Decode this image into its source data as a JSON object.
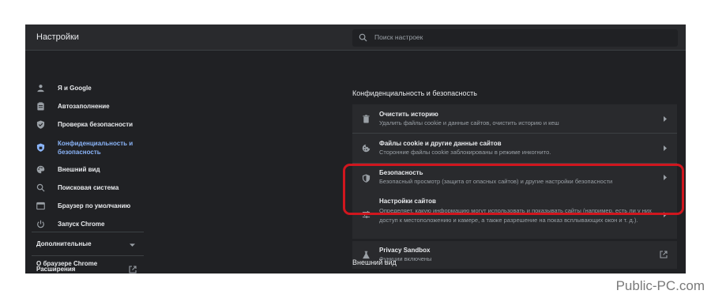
{
  "app": {
    "title": "Настройки"
  },
  "search": {
    "placeholder": "Поиск настроек"
  },
  "sidebar": {
    "items": [
      {
        "label": "Я и Google",
        "icon": "person-icon"
      },
      {
        "label": "Автозаполнение",
        "icon": "clipboard-icon"
      },
      {
        "label": "Проверка безопасности",
        "icon": "shield-icon"
      },
      {
        "label": "Конфиденциальность и безопасность",
        "icon": "shield-lock-icon",
        "active": true
      },
      {
        "label": "Внешний вид",
        "icon": "palette-icon"
      },
      {
        "label": "Поисковая система",
        "icon": "search-icon"
      },
      {
        "label": "Браузер по умолчанию",
        "icon": "browser-icon"
      },
      {
        "label": "Запуск Chrome",
        "icon": "power-icon"
      }
    ],
    "advanced": "Дополнительные",
    "extensions": "Расширения",
    "about": "О браузере Chrome"
  },
  "main": {
    "section_privacy": "Конфиденциальность и безопасность",
    "rows": [
      {
        "title": "Очистить историю",
        "sub": "Удалить файлы cookie и данные сайтов, очистить историю и кеш",
        "icon": "trash-icon"
      },
      {
        "title": "Файлы cookie и другие данные сайтов",
        "sub": "Сторонние файлы cookie заблокированы в режиме инкогнито.",
        "icon": "cookie-icon"
      },
      {
        "title": "Безопасность",
        "sub": "Безопасный просмотр (защита от опасных сайтов) и другие настройки безопасности",
        "icon": "shield-icon"
      },
      {
        "title": "Настройки сайтов",
        "sub": "Определяет, какую информацию могут использовать и показывать сайты (например, есть ли у них доступ к местоположению и камере, а также разрешение на показ всплывающих окон и т. д.).",
        "icon": "tune-icon"
      }
    ],
    "sandbox": {
      "title": "Privacy Sandbox",
      "sub": "Функции включены",
      "icon": "flask-icon"
    },
    "section_appearance": "Внешний вид"
  },
  "watermark": "Public-PC.com",
  "colors": {
    "background": "#202124",
    "surface": "#292a2d",
    "accent": "#8ab4f8",
    "highlight": "#d0161e"
  }
}
